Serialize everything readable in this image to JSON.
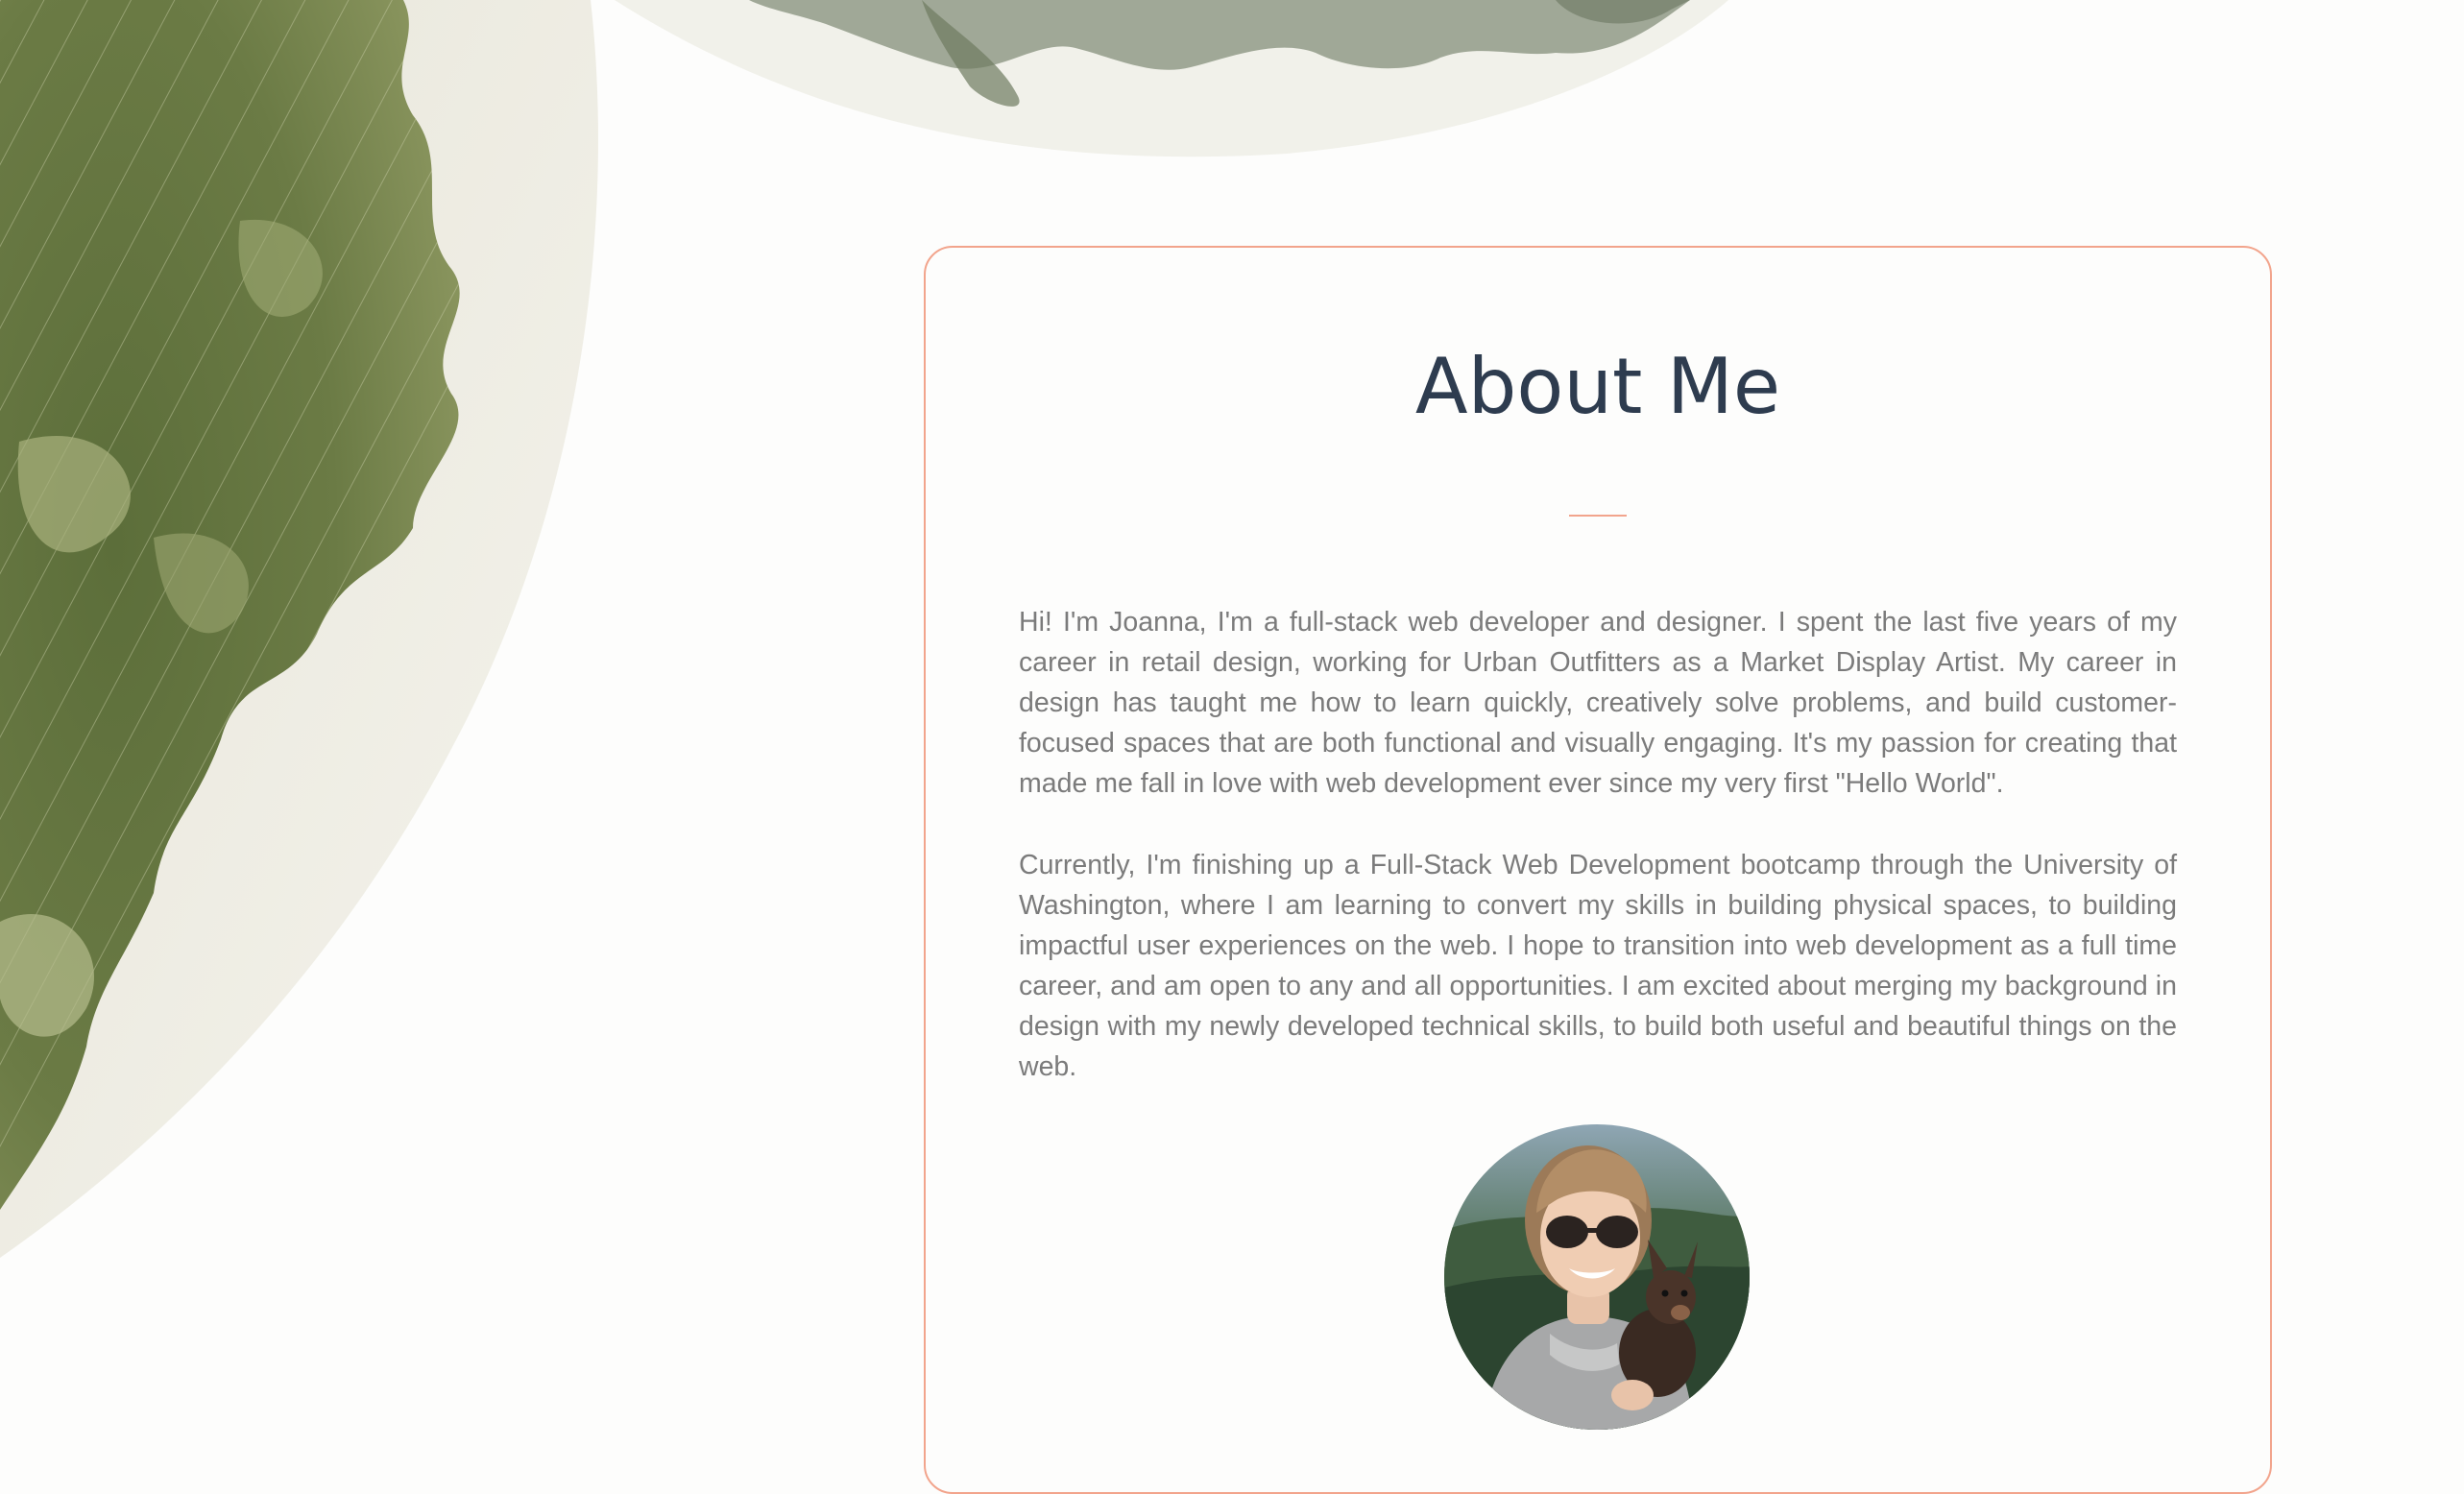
{
  "about": {
    "title": "About Me",
    "paragraphs": [
      "Hi! I'm Joanna, I'm a full-stack web developer and designer. I spent the last five years of my career in retail design, working for Urban Outfitters as a Market Display Artist. My career in design has taught me how to learn quickly, creatively solve problems, and build customer-focused spaces that are both functional and visually engaging. It's my passion for creating that made me fall in love with web development ever since my very first \"Hello World\".",
      "Currently, I'm finishing up a Full-Stack Web Development bootcamp through the University of Washington, where I am learning to convert my skills in building physical spaces, to building impactful user experiences on the web. I hope to transition into web development as a full time career, and am open to any and all opportunities. I am excited about merging my background in design with my newly developed technical skills, to build both useful and beautiful things on the web."
    ]
  },
  "theme": {
    "accent": "#f2a48c",
    "heading": "#2e3c4f",
    "body_text": "#7b7b7b",
    "background": "#fdfdfc"
  },
  "icons": {
    "leaf_large": "variegated-leaf-image",
    "leaf_top": "variegated-leaf-image",
    "profile": "profile-photo"
  }
}
